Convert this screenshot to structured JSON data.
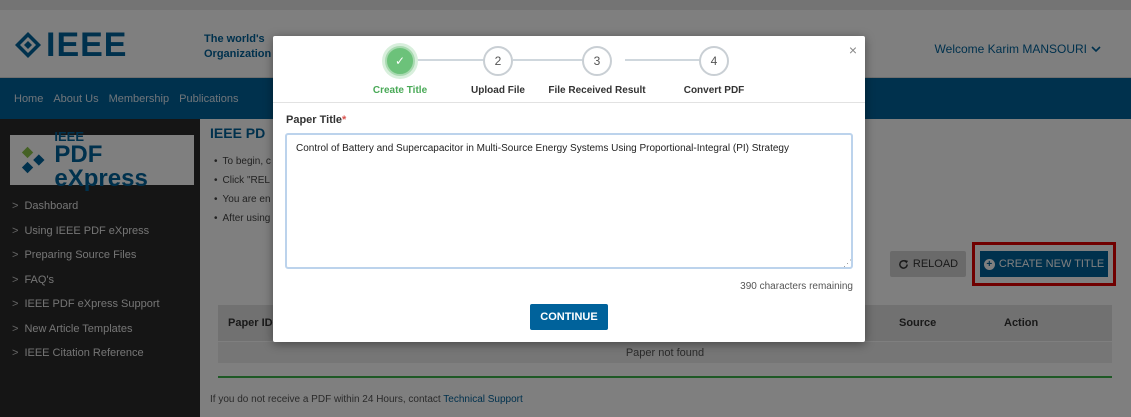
{
  "header": {
    "logo_text": "IEEE",
    "tagline_line1": "The world's",
    "tagline_line2": "Organization",
    "welcome": "Welcome Karim MANSOURI"
  },
  "nav": {
    "items": [
      "Home",
      "About Us",
      "Membership",
      "Publications"
    ]
  },
  "sidebar": {
    "logo_ieee": "IEEE",
    "logo_name": "PDF eXpress",
    "items": [
      "Dashboard",
      "Using IEEE PDF eXpress",
      "Preparing Source Files",
      "FAQ's",
      "IEEE PDF eXpress Support",
      "New Article Templates",
      "IEEE Citation Reference"
    ]
  },
  "content": {
    "title": "IEEE PD",
    "bullets": [
      "To begin, c",
      "Click \"REL",
      "You are en",
      "After using"
    ],
    "reload_label": "RELOAD",
    "create_label": "CREATE NEW TITLE",
    "table": {
      "headers": [
        "Paper ID",
        "Source",
        "Action"
      ],
      "empty_message": "Paper not found"
    },
    "footer_text": "If you do not receive a PDF within 24 Hours, contact ",
    "footer_link": "Technical Support"
  },
  "modal": {
    "steps": [
      {
        "label": "Create Title",
        "number": "✓",
        "state": "done"
      },
      {
        "label": "Upload File",
        "number": "2",
        "state": "pending"
      },
      {
        "label": "File Received Result",
        "number": "3",
        "state": "pending"
      },
      {
        "label": "Convert PDF",
        "number": "4",
        "state": "pending"
      }
    ],
    "field_label": "Paper Title",
    "required_mark": "*",
    "paper_title": "Control of Battery and Supercapacitor in Multi-Source Energy Systems Using Proportional-Integral (PI) Strategy",
    "remaining_text": "390 characters remaining",
    "continue_label": "CONTINUE",
    "close_symbol": "×"
  },
  "colors": {
    "ieee_blue": "#00629b",
    "step_done": "#6cc27a",
    "highlight_red": "#e00000"
  }
}
